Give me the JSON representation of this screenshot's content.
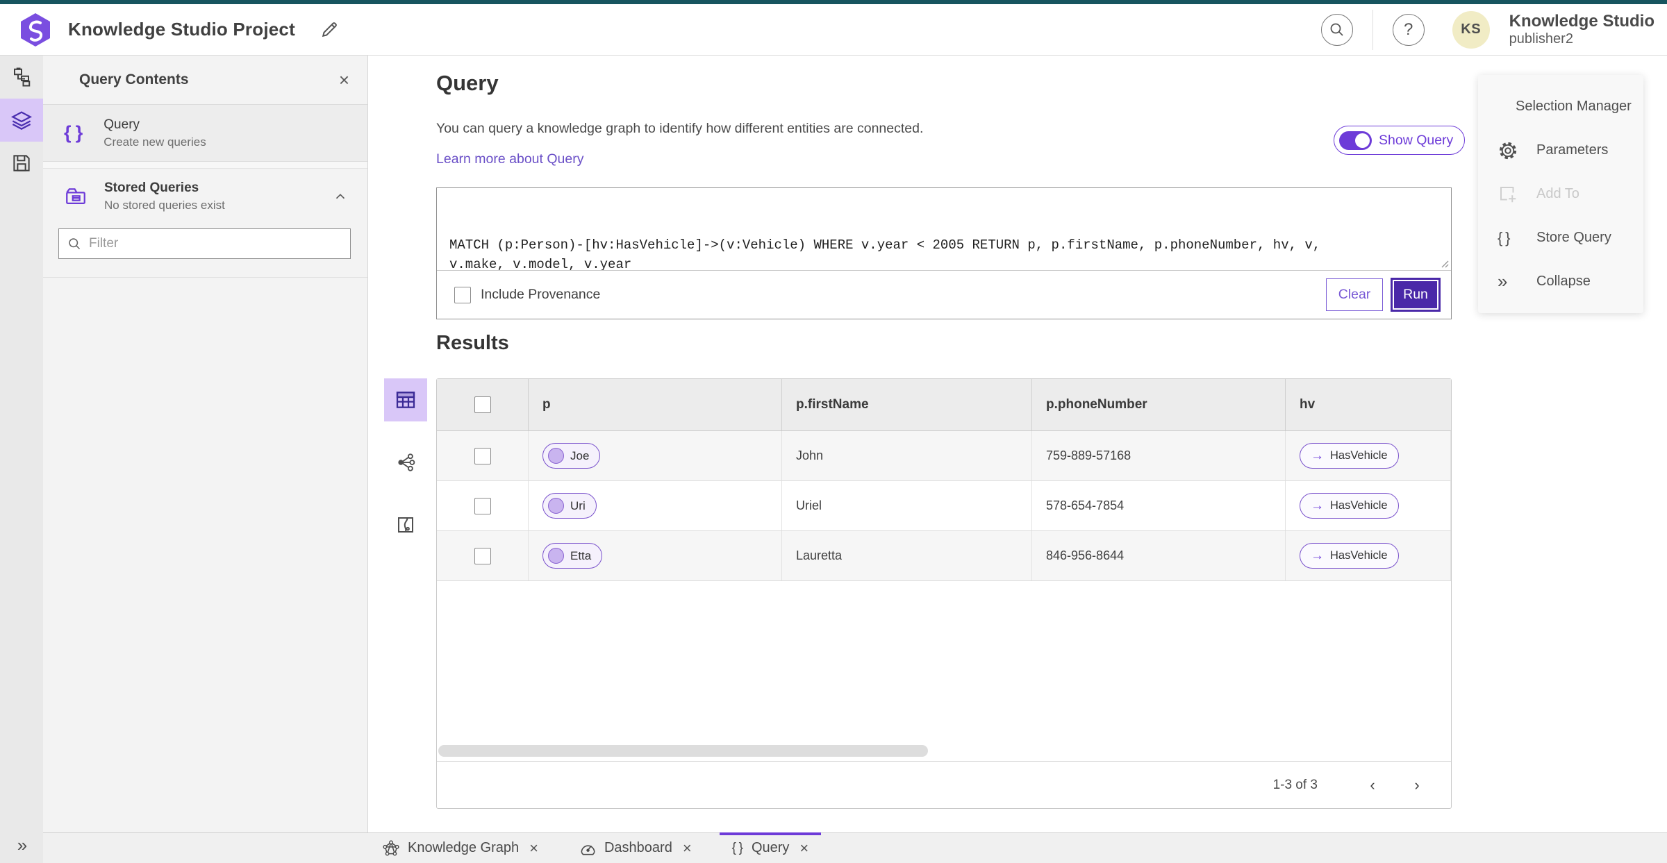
{
  "header": {
    "app_title": "Knowledge Studio Project",
    "user_name": "Knowledge Studio",
    "user_role": "publisher2",
    "avatar_initials": "KS"
  },
  "left_rail": {
    "items": [
      {
        "icon": "data-model-icon",
        "selected": false
      },
      {
        "icon": "layers-icon",
        "selected": true
      },
      {
        "icon": "save-icon",
        "selected": false
      }
    ],
    "expand_icon": "»"
  },
  "contents_panel": {
    "title": "Query Contents",
    "close_icon": "×",
    "query_item": {
      "label": "Query",
      "description": "Create new queries",
      "icon": "braces-icon"
    },
    "stored_item": {
      "label": "Stored Queries",
      "description": "No stored queries exist",
      "icon": "folder-icon"
    },
    "filter_placeholder": "Filter"
  },
  "query_panel": {
    "title": "Query",
    "description": "You can query a knowledge graph to identify how different entities are connected.",
    "learn_more_label": "Learn more about Query",
    "show_query_label": "Show Query",
    "show_query_on": true,
    "query_text": "MATCH (p:Person)-[hv:HasVehicle]->(v:Vehicle) WHERE v.year < 2005 RETURN p, p.firstName, p.phoneNumber, hv, v, v.make, v.model, v.year",
    "include_provenance_label": "Include Provenance",
    "include_provenance_checked": false,
    "clear_label": "Clear",
    "run_label": "Run"
  },
  "side_menu": {
    "items": [
      {
        "label": "Selection Manager",
        "icon": "selection-manager-icon",
        "disabled": false
      },
      {
        "label": "Parameters",
        "icon": "gear-icon",
        "disabled": false
      },
      {
        "label": "Add To",
        "icon": "add-to-icon",
        "disabled": true
      },
      {
        "label": "Store Query",
        "icon": "braces-icon",
        "disabled": false
      },
      {
        "label": "Collapse",
        "icon": "double-chevron-icon",
        "disabled": false
      }
    ]
  },
  "results": {
    "title": "Results",
    "view_icons": [
      "table-view-icon",
      "link-chart-view-icon",
      "map-view-icon"
    ],
    "columns": [
      "p",
      "p.firstName",
      "p.phoneNumber",
      "hv"
    ],
    "rows": [
      {
        "p": "Joe",
        "firstName": "John",
        "phoneNumber": "759-889-57168",
        "hv": "HasVehicle"
      },
      {
        "p": "Uri",
        "firstName": "Uriel",
        "phoneNumber": "578-654-7854",
        "hv": "HasVehicle"
      },
      {
        "p": "Etta",
        "firstName": "Lauretta",
        "phoneNumber": "846-956-8644",
        "hv": "HasVehicle"
      }
    ],
    "rel_arrow": "→",
    "pagination": "1-3 of 3",
    "prev_icon": "‹",
    "next_icon": "›"
  },
  "tabs": [
    {
      "label": "Knowledge Graph",
      "icon": "graph-icon",
      "active": false
    },
    {
      "label": "Dashboard",
      "icon": "gauge-icon",
      "active": false
    },
    {
      "label": "Query",
      "icon": "braces-icon",
      "active": true
    }
  ],
  "colors": {
    "accent_purple": "#6d3bd8",
    "run_button": "#4a28a8",
    "top_strip_teal": "#17555f",
    "rail_selected": "#d9c7f8",
    "avatar_bg": "#f1ecc5"
  }
}
